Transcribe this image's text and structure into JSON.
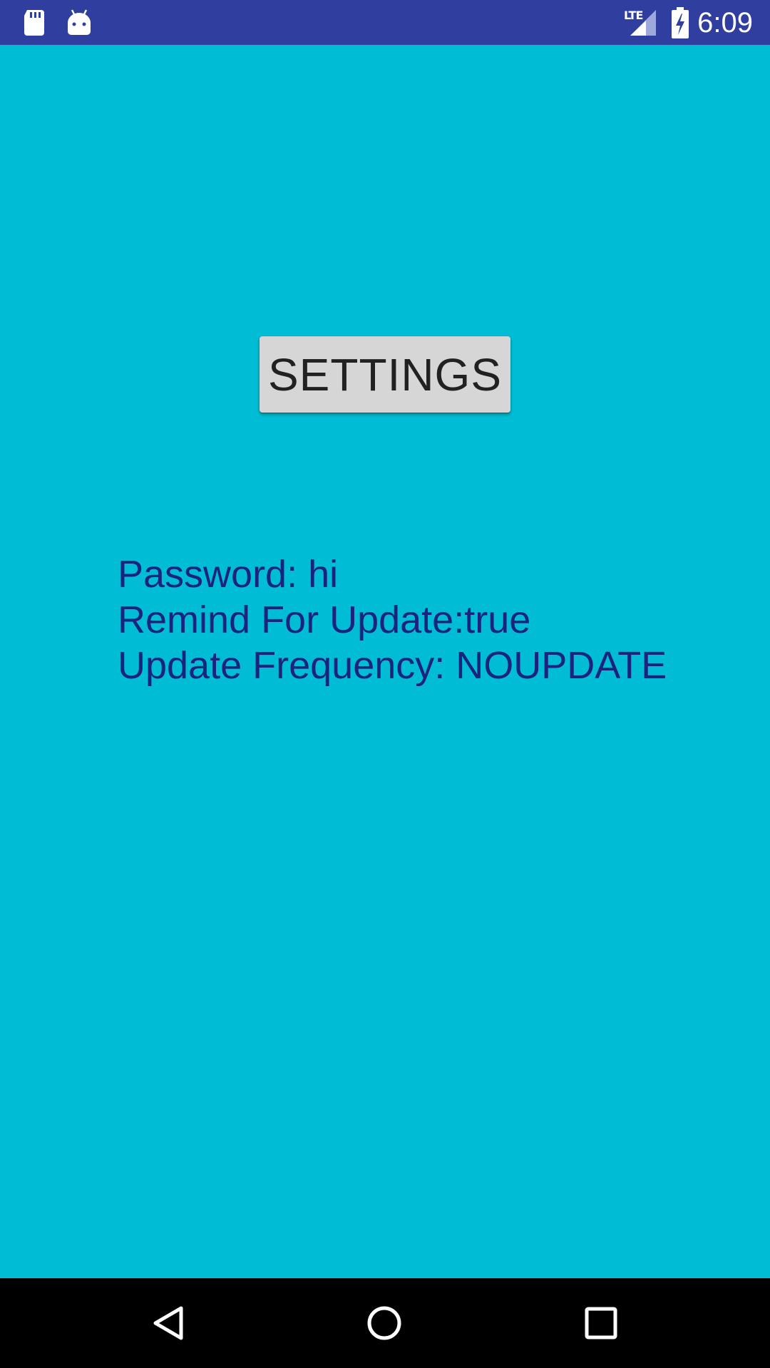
{
  "status_bar": {
    "network_label": "LTE",
    "time": "6:09",
    "background_color": "#303f9f",
    "icons": [
      "sd-card-icon",
      "android-icon",
      "signal-icon",
      "battery-charging-icon"
    ]
  },
  "main": {
    "background_color": "#00bcd4",
    "settings_button_label": "SETTINGS",
    "info_lines": {
      "password": "Password: hi",
      "remind": "Remind For Update:true",
      "frequency": "Update Frequency: NOUPDATE"
    },
    "text_color": "#1a237e"
  },
  "nav_bar": {
    "icons": [
      "back-icon",
      "home-icon",
      "recents-icon"
    ]
  }
}
